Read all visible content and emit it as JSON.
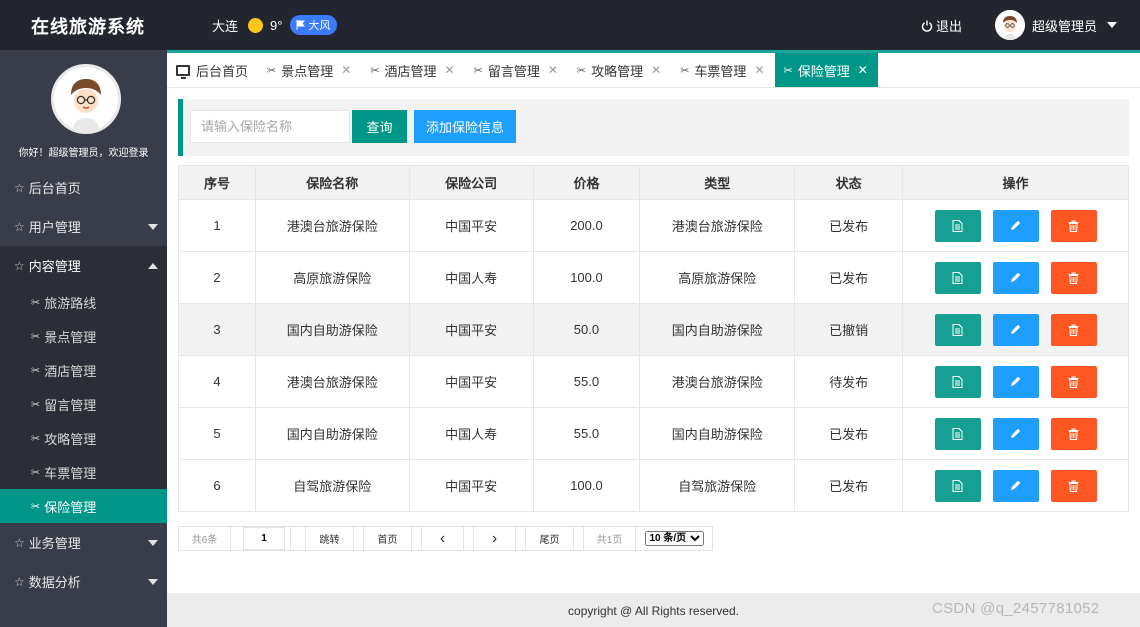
{
  "header": {
    "title": "在线旅游系统",
    "city": "大连",
    "temperature": "9°",
    "wind": "大风",
    "logout": "退出",
    "user_name": "超级管理员"
  },
  "sidebar": {
    "welcome": "你好！超级管理员，欢迎登录",
    "items": [
      {
        "label": "后台首页"
      },
      {
        "label": "用户管理"
      },
      {
        "label": "内容管理"
      },
      {
        "label": "业务管理"
      },
      {
        "label": "数据分析"
      }
    ],
    "content_sub": [
      {
        "label": "旅游路线"
      },
      {
        "label": "景点管理"
      },
      {
        "label": "酒店管理"
      },
      {
        "label": "留言管理"
      },
      {
        "label": "攻略管理"
      },
      {
        "label": "车票管理"
      },
      {
        "label": "保险管理"
      }
    ]
  },
  "tabs": [
    {
      "label": "后台首页"
    },
    {
      "label": "景点管理"
    },
    {
      "label": "酒店管理"
    },
    {
      "label": "留言管理"
    },
    {
      "label": "攻略管理"
    },
    {
      "label": "车票管理"
    },
    {
      "label": "保险管理"
    }
  ],
  "search": {
    "placeholder": "请输入保险名称",
    "search_label": "查询",
    "add_label": "添加保险信息"
  },
  "table": {
    "headers": [
      "序号",
      "保险名称",
      "保险公司",
      "价格",
      "类型",
      "状态",
      "操作"
    ],
    "rows": [
      {
        "no": "1",
        "name": "港澳台旅游保险",
        "company": "中国平安",
        "price": "200.0",
        "type": "港澳台旅游保险",
        "status": "已发布"
      },
      {
        "no": "2",
        "name": "高原旅游保险",
        "company": "中国人寿",
        "price": "100.0",
        "type": "高原旅游保险",
        "status": "已发布"
      },
      {
        "no": "3",
        "name": "国内自助游保险",
        "company": "中国平安",
        "price": "50.0",
        "type": "国内自助游保险",
        "status": "已撤销"
      },
      {
        "no": "4",
        "name": "港澳台旅游保险",
        "company": "中国平安",
        "price": "55.0",
        "type": "港澳台旅游保险",
        "status": "待发布"
      },
      {
        "no": "5",
        "name": "国内自助游保险",
        "company": "中国人寿",
        "price": "55.0",
        "type": "国内自助游保险",
        "status": "已发布"
      },
      {
        "no": "6",
        "name": "自驾旅游保险",
        "company": "中国平安",
        "price": "100.0",
        "type": "自驾旅游保险",
        "status": "已发布"
      }
    ]
  },
  "pager": {
    "total": "共6条",
    "page": "1",
    "jump": "跳转",
    "first": "首页",
    "last": "尾页",
    "pages": "共1页",
    "per_page": "10 条/页"
  },
  "footer": {
    "copyright": "copyright @ All Rights reserved."
  },
  "watermark": "CSDN @q_2457781052",
  "colors": {
    "primary": "#009688",
    "blue": "#1e9fff",
    "danger": "#ff5722",
    "header_bg": "#23262e",
    "sidebar_bg": "#393d49"
  }
}
